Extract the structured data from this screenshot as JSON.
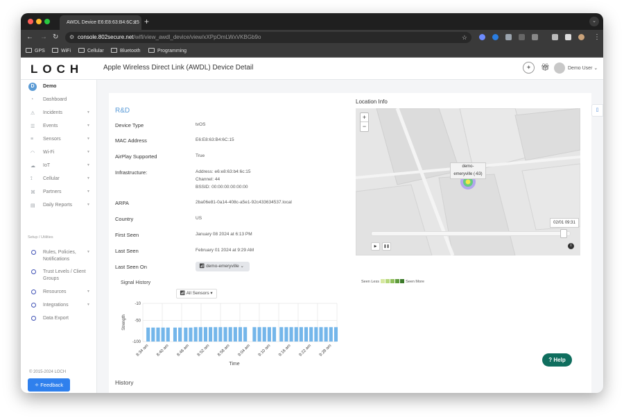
{
  "browser": {
    "tab_title": "AWDL Device E6:E8:63:B4:6C:15",
    "url_host": "console.802secure.net",
    "url_path": "/wifi/view_awdl_device/view/xXPpOmLWxVKBGb9o",
    "bookmarks": [
      "GPS",
      "WiFi",
      "Cellular",
      "Bluetooth",
      "Programming"
    ]
  },
  "header": {
    "logo": "LOCH",
    "page_title": "Apple Wireless Direct Link (AWDL) Device Detail",
    "user": "Demo User"
  },
  "sidebar": {
    "org_initial": "D",
    "org_name": "Demo",
    "items": [
      {
        "label": "Dashboard",
        "icon": "dashboard-icon",
        "glyph": "◔"
      },
      {
        "label": "Incidents",
        "icon": "warning-icon",
        "glyph": "⚠"
      },
      {
        "label": "Events",
        "icon": "layers-icon",
        "glyph": "☰"
      },
      {
        "label": "Sensors",
        "icon": "sensor-icon",
        "glyph": "≡"
      },
      {
        "label": "Wi-Fi",
        "icon": "wifi-icon",
        "glyph": "◠"
      },
      {
        "label": "IoT",
        "icon": "cloud-icon",
        "glyph": "☁"
      },
      {
        "label": "Cellular",
        "icon": "antenna-icon",
        "glyph": "⟟"
      },
      {
        "label": "Partners",
        "icon": "handshake-icon",
        "glyph": "⌘"
      },
      {
        "label": "Daily Reports",
        "icon": "report-icon",
        "glyph": "▤"
      }
    ],
    "section_label": "Setup / Utilities",
    "utilities": [
      {
        "label": "Rules, Policies,",
        "label2": "Notifications"
      },
      {
        "label": "Trust Levels / Client",
        "label2": "Groups"
      },
      {
        "label": "Resources",
        "label2": ""
      },
      {
        "label": "Integrations",
        "label2": ""
      },
      {
        "label": "Data Export",
        "label2": ""
      }
    ],
    "copyright": "© 2015-2024 LOCH",
    "feedback": "Feedback"
  },
  "device": {
    "section_title": "R&D",
    "fields": [
      {
        "label": "Device Type",
        "value": "tvOS"
      },
      {
        "label": "MAC Address",
        "value": "E6:E8:63:B4:6C:15"
      },
      {
        "label": "AirPlay Supported",
        "value": "True"
      },
      {
        "label": "Infrastructure:",
        "value": "Address: e6:e8:63:b4:6c:15",
        "value2": "Channel: 44",
        "value3": "BSSID: 00:00:00:00:00:00"
      },
      {
        "label": "ARPA",
        "value": "2ba06e81-0a14-408c-a5e1-92c433634537.local"
      },
      {
        "label": "Country",
        "value": "US"
      },
      {
        "label": "First Seen",
        "value": "January 08 2024 at 6:13 PM"
      },
      {
        "label": "Last Seen",
        "value": "February 01 2024 at 9:29 AM"
      },
      {
        "label": "Last Seen On",
        "value": "demo-emeryville"
      }
    ]
  },
  "signal": {
    "title": "Signal History",
    "sensor_select": "All Sensors",
    "history_title": "History"
  },
  "location": {
    "title": "Location Info",
    "popup_line1": "demo-",
    "popup_line2": "emeryville (-63)",
    "time_label": "02/01 09:31",
    "legend_less": "Seen Less",
    "legend_more": "Seen More",
    "legend_colors": [
      "#d6e8a0",
      "#b5d77a",
      "#8fbf5a",
      "#5e9b3c",
      "#3c7a2a"
    ]
  },
  "help": "Help",
  "chart_data": {
    "type": "bar",
    "xlabel": "Time",
    "ylabel": "Strength",
    "ylim": [
      -100,
      -10
    ],
    "yticks": [
      -10,
      -50,
      -100
    ],
    "xticks": [
      "8:34 am",
      "8:40 am",
      "8:46 am",
      "8:52 am",
      "8:58 am",
      "9:04 am",
      "9:10 am",
      "9:16 am",
      "9:22 am",
      "9:28 am"
    ],
    "values": [
      -67,
      -67,
      -67,
      -67,
      -67,
      -67,
      -67,
      -67,
      -67,
      -66,
      -66,
      -66,
      -66,
      -66,
      -66,
      -66,
      -66,
      -66,
      -66,
      -66,
      -66,
      -66,
      -66,
      -66,
      -66,
      -66,
      -66,
      -66,
      -66,
      -66,
      -66,
      -66,
      -66,
      -66,
      -66,
      -66,
      -66
    ],
    "x_positions": [
      0.5,
      1.2,
      1.9,
      2.6,
      3.3,
      4.3,
      5.0,
      5.8,
      6.5,
      7.2,
      7.9,
      8.6,
      9.3,
      10.0,
      10.7,
      11.4,
      12.1,
      12.8,
      13.5,
      14.2,
      15.5,
      16.2,
      16.9,
      17.6,
      18.3,
      19.3,
      20.0,
      20.7,
      21.4,
      22.1,
      22.8,
      23.5,
      24.2,
      24.9,
      25.6,
      26.3,
      27.0
    ],
    "x_count": 27.4,
    "bar_color": "#74b6ea"
  }
}
